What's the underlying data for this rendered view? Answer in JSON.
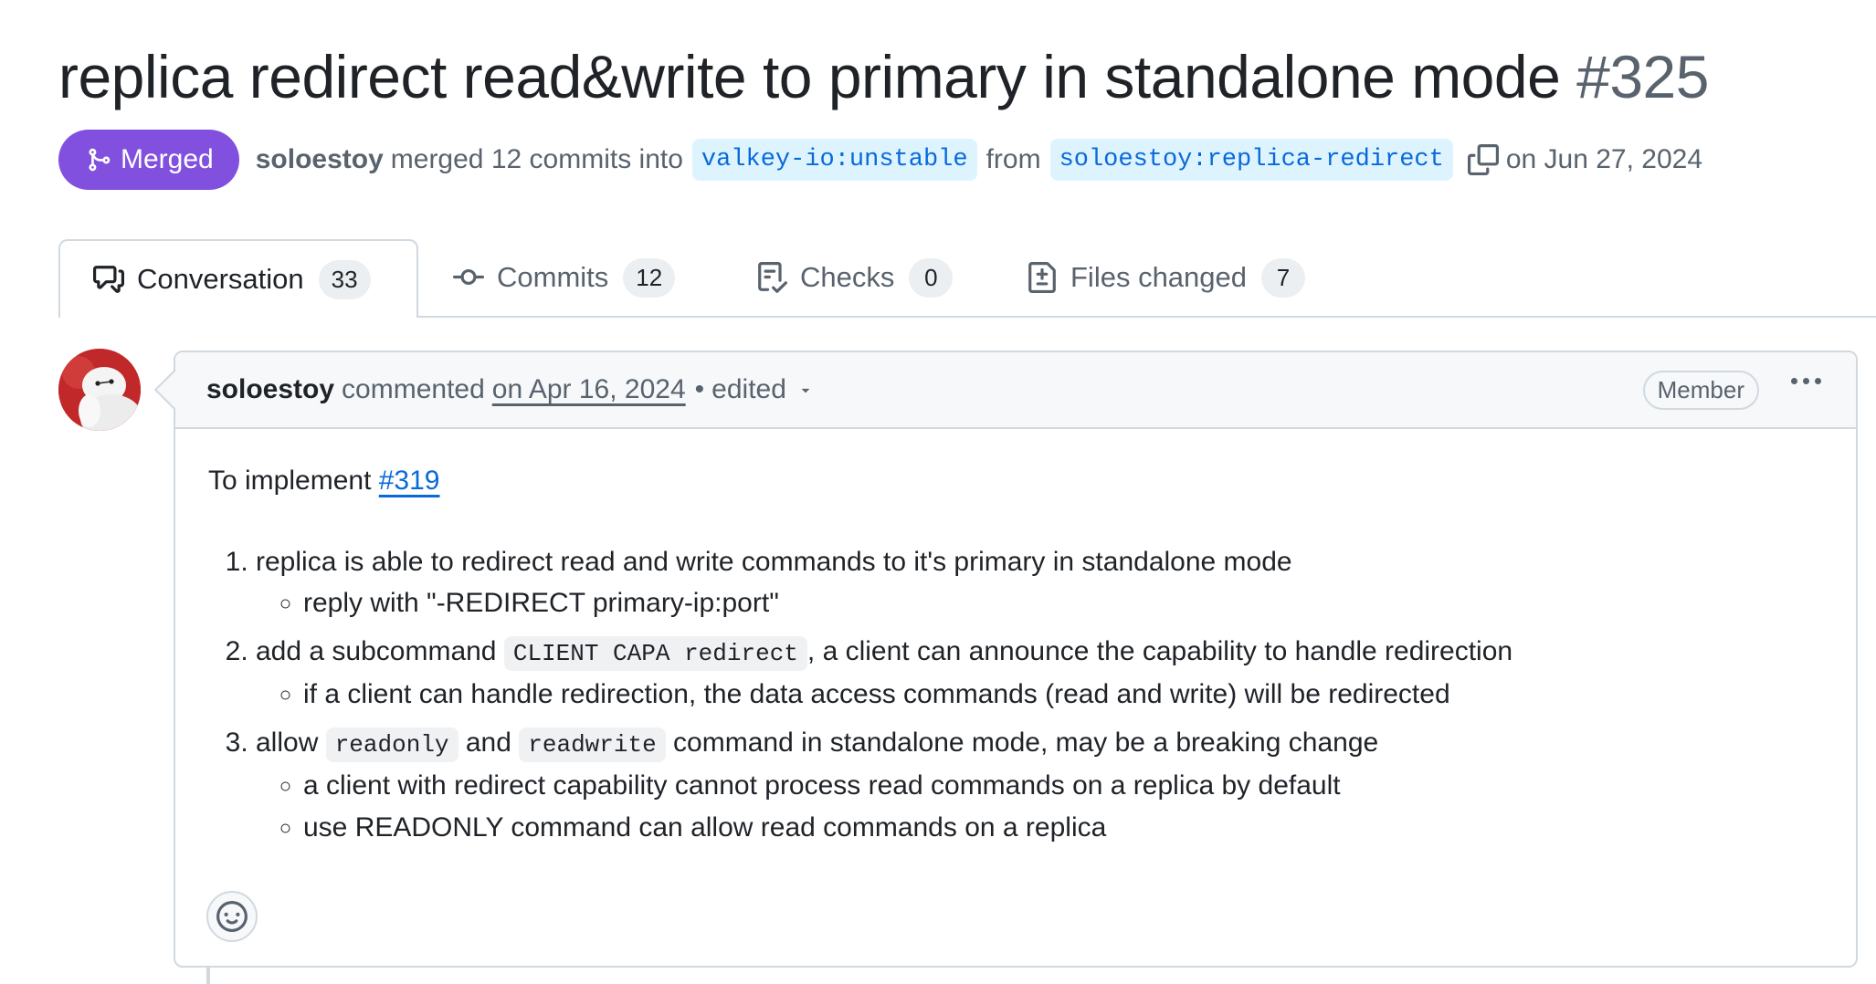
{
  "pr": {
    "title": "replica redirect read&write to primary in standalone mode",
    "number": "#325",
    "state": "Merged",
    "author": "soloestoy",
    "merged_text": "merged 12 commits into",
    "base_branch": "valkey-io:unstable",
    "from_text": "from",
    "head_branch": "soloestoy:replica-redirect",
    "date_text": "on Jun 27, 2024"
  },
  "tabs": [
    {
      "label": "Conversation",
      "count": "33",
      "icon": "comment-discussion-icon",
      "selected": true
    },
    {
      "label": "Commits",
      "count": "12",
      "icon": "git-commit-icon"
    },
    {
      "label": "Checks",
      "count": "0",
      "icon": "checklist-icon"
    },
    {
      "label": "Files changed",
      "count": "7",
      "icon": "file-diff-icon"
    }
  ],
  "comment": {
    "author": "soloestoy",
    "action": "commented",
    "date": "on Apr 16, 2024",
    "separator": "•",
    "edited": "edited",
    "role": "Member",
    "intro": "To implement ",
    "issue_link": "#319",
    "items": [
      {
        "text": "replica is able to redirect read and write commands to it's primary in standalone mode",
        "sub": [
          "reply with \"-REDIRECT primary-ip:port\""
        ]
      },
      {
        "pre": "add a subcommand ",
        "code": "CLIENT CAPA redirect",
        "post": ", a client can announce the capability to handle redirection",
        "sub": [
          "if a client can handle redirection, the data access commands (read and write) will be redirected"
        ]
      },
      {
        "pre": "allow ",
        "code": "readonly",
        "mid": " and ",
        "code2": "readwrite",
        "post": " command in standalone mode, may be a breaking change",
        "sub": [
          "a client with redirect capability cannot process read commands on a replica by default",
          "use READONLY command can allow read commands on a replica"
        ]
      }
    ]
  },
  "colors": {
    "merged": "#8250df",
    "link": "#0969da",
    "muted": "#59636e",
    "border": "#d1d9e0"
  }
}
